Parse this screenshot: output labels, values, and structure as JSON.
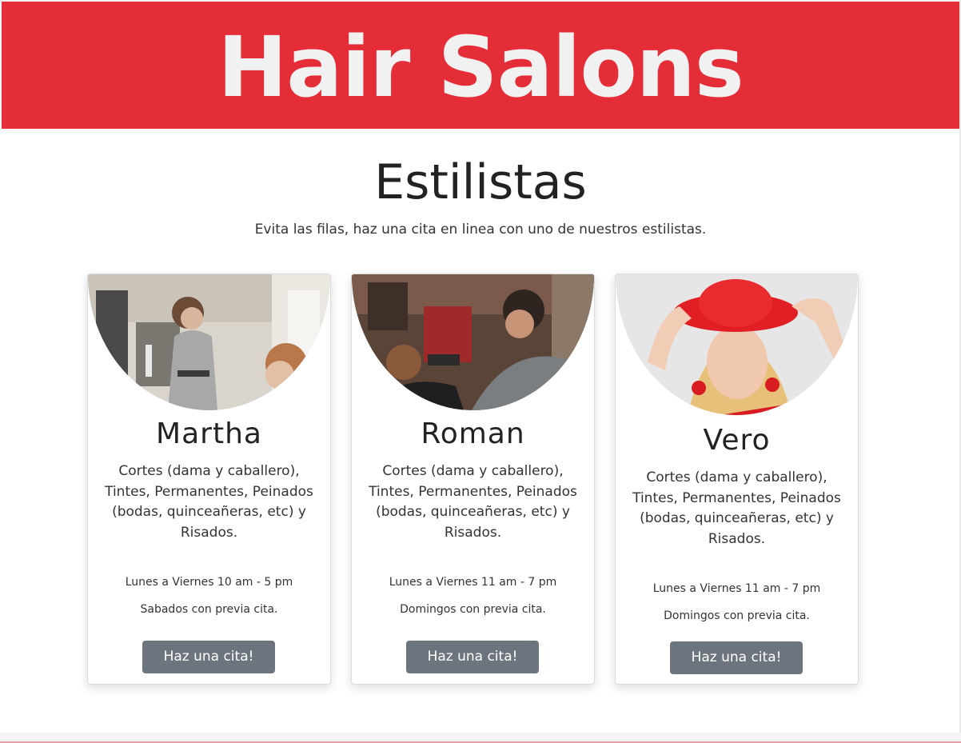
{
  "header": {
    "title": "Hair Salons"
  },
  "section": {
    "title": "Estilistas",
    "subtitle": "Evita las filas, haz una cita en linea con uno de nuestros estilistas."
  },
  "stylists": [
    {
      "name": "Martha",
      "services": "Cortes (dama y caballero), Tintes, Permanentes, Peinados (bodas, quinceañeras, etc) y Risados.",
      "hours": "Lunes a Viernes 10 am - 5 pm",
      "extra": "Sabados con previa cita.",
      "button": "Haz una cita!"
    },
    {
      "name": "Roman",
      "services": "Cortes (dama y caballero), Tintes, Permanentes, Peinados (bodas, quinceañeras, etc) y Risados.",
      "hours": "Lunes a Viernes 11 am - 7 pm",
      "extra": "Domingos con previa cita.",
      "button": "Haz una cita!"
    },
    {
      "name": "Vero",
      "services": "Cortes (dama y caballero), Tintes, Permanentes, Peinados (bodas, quinceañeras, etc) y Risados.",
      "hours": "Lunes a Viernes 11 am - 7 pm",
      "extra": "Domingos con previa cita.",
      "button": "Haz una cita!"
    }
  ],
  "colors": {
    "brand_red": "#e52d38",
    "button_gray": "#6c757d",
    "header_text": "#f1f1f1"
  }
}
